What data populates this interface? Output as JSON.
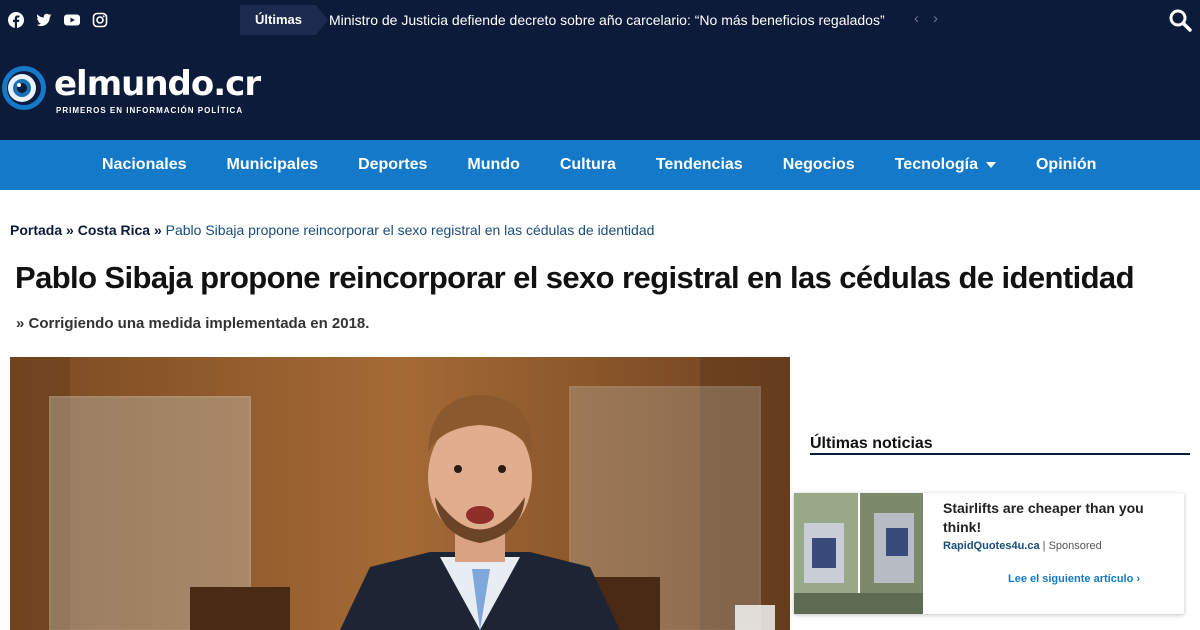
{
  "topbar": {
    "social": [
      "facebook-icon",
      "twitter-icon",
      "youtube-icon",
      "instagram-icon"
    ],
    "ticker_label": "Últimas",
    "ticker_headline": "Ministro de Justicia defiende decreto sobre año carcelario: “No más beneficios regalados”",
    "ticker_prev": "‹",
    "ticker_next": "›",
    "search_icon": "search-icon"
  },
  "header": {
    "logo_text": "elmundo.cr",
    "logo_tagline": "PRIMEROS EN INFORMACIÓN POLÍTICA",
    "logo_icon": "eye-logo-icon"
  },
  "nav": {
    "items": [
      "Nacionales",
      "Municipales",
      "Deportes",
      "Mundo",
      "Cultura",
      "Tendencias",
      "Negocios",
      "Tecnología",
      "Opinión"
    ]
  },
  "breadcrumb": {
    "home": "Portada",
    "sep": "»",
    "section": "Costa Rica",
    "current": "Pablo Sibaja propone reincorporar el sexo registral en las cédulas de identidad"
  },
  "article": {
    "title": "Pablo Sibaja propone reincorporar el sexo registral en las cédulas de identidad",
    "subtitle": "» Corrigiendo una medida implementada en 2018."
  },
  "sidebar": {
    "heading": "Últimas noticias",
    "ad": {
      "title": "Stairlifts are cheaper than you think!",
      "source": "RapidQuotes4u.ca",
      "separator": "|",
      "sponsored": "Sponsored",
      "next_label": "Lee el siguiente artículo ›"
    }
  },
  "colors": {
    "navy": "#0c1b3a",
    "nav_blue": "#1479c9",
    "link_blue": "#1a4d7a"
  }
}
